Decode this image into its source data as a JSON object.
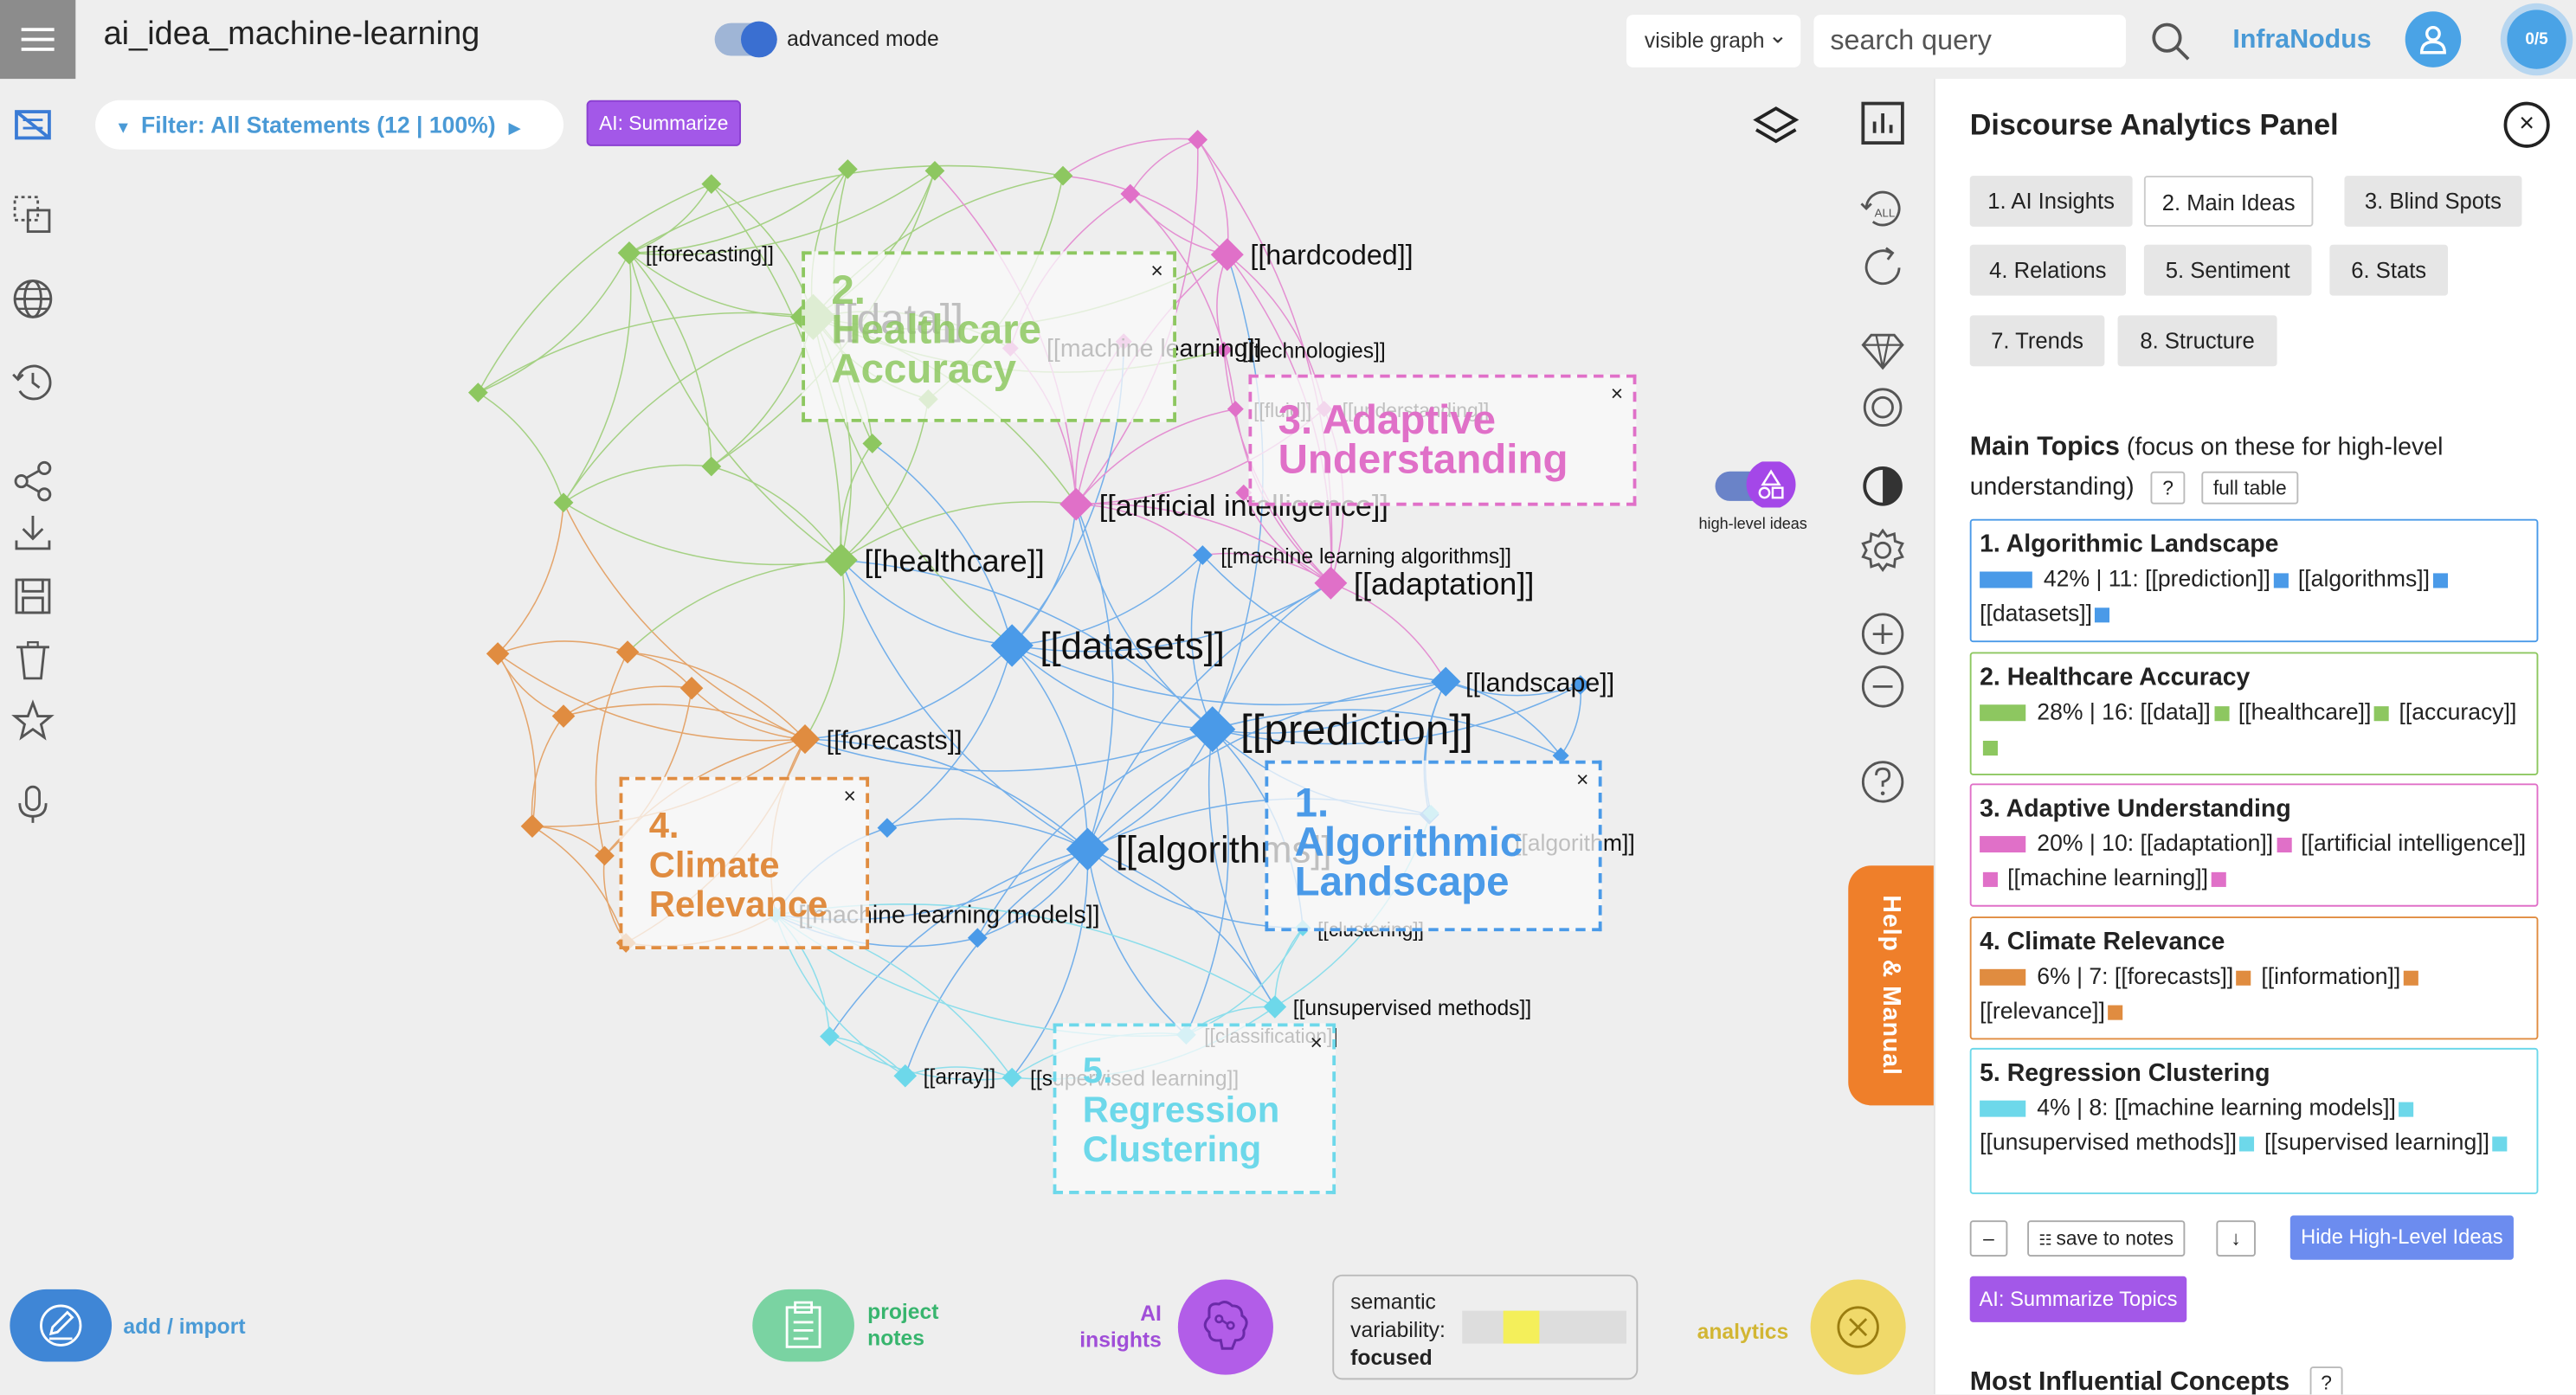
{
  "header": {
    "title": "ai_idea_machine-learning",
    "advanced_mode_label": "advanced mode",
    "graph_select": "visible graph",
    "search_placeholder": "search query",
    "brand": "InfraNodus",
    "counter": "0/5"
  },
  "toolbar": {
    "filter_label": "Filter: All Statements (12 | 100%)",
    "ai_summarize": "AI: Summarize"
  },
  "graph": {
    "topics": [
      {
        "num": "1.",
        "line1": "Algorithmic",
        "line2": "Landscape",
        "color": "#4a9ae8"
      },
      {
        "num": "2.",
        "line1": "Healthcare",
        "line2": "Accuracy",
        "color": "#8dc760"
      },
      {
        "num": "3.",
        "line1": "Adaptive",
        "line2": "Understanding",
        "color": "#e070c8"
      },
      {
        "num": "4.",
        "line1": "Climate",
        "line2": "Relevance",
        "color": "#e08c40"
      },
      {
        "num": "5.",
        "line1": "Regression",
        "line2": "Clustering",
        "color": "#6dd8ea"
      }
    ],
    "close_mark": "×",
    "node_labels": {
      "forecasting": "[[forecasting]]",
      "data": "[[data]]",
      "machine_learning": "[[machine learning]]",
      "technologies": "[[technologies]]",
      "hardcoded": "[[hardcoded]]",
      "fluid": "[[fluid]]",
      "understanding": "[[understanding]]",
      "artificial_intelligence": "[[artificial intelligence]]",
      "healthcare": "[[healthcare]]",
      "ml_algorithms": "[[machine learning algorithms]]",
      "adaptation": "[[adaptation]]",
      "datasets": "[[datasets]]",
      "landscape": "[[landscape]]",
      "prediction": "[[prediction]]",
      "forecasts": "[[forecasts]]",
      "algorithms": "[[algorithms]]",
      "algorithm": "[[algorithm]]",
      "ml_models": "[[machine learning models]]",
      "clustering": "[[clustering]]",
      "unsupervised": "[[unsupervised methods]]",
      "classification": "[[classification]]",
      "array": "[[array]]",
      "supervised": "[[supervised learning]]"
    },
    "high_level_ideas_label": "high-level ideas"
  },
  "help_label": "Help & Manual",
  "panel": {
    "title": "Discourse Analytics Panel",
    "tabs": [
      "1. AI Insights",
      "2. Main Ideas",
      "3. Blind Spots",
      "4. Relations",
      "5. Sentiment",
      "6. Stats",
      "7. Trends",
      "8. Structure"
    ],
    "main_topics_title": "Main Topics",
    "main_topics_note": "(focus on these for high-level understanding)",
    "question_mark": "?",
    "full_table": "full table",
    "topics": [
      {
        "title": "1. Algorithmic Landscape",
        "pct": 42,
        "stat": "42% | 11:",
        "terms": [
          "[[prediction]]",
          "[[algorithms]]",
          "[[datasets]]"
        ],
        "color": "#4a9ae8"
      },
      {
        "title": "2. Healthcare Accuracy",
        "pct": 28,
        "stat": "28% | 16:",
        "terms": [
          "[[data]]",
          "[[healthcare]]",
          "[[accuracy]]"
        ],
        "color": "#8dc760"
      },
      {
        "title": "3. Adaptive Understanding",
        "pct": 20,
        "stat": "20% | 10:",
        "terms": [
          "[[adaptation]]",
          "[[artificial intelligence]]",
          "[[machine learning]]"
        ],
        "color": "#e070c8"
      },
      {
        "title": "4. Climate Relevance",
        "pct": 6,
        "stat": "6% | 7:",
        "terms": [
          "[[forecasts]]",
          "[[information]]",
          "[[relevance]]"
        ],
        "color": "#e08c40"
      },
      {
        "title": "5. Regression Clustering",
        "pct": 4,
        "stat": "4% | 8:",
        "terms": [
          "[[machine learning models]]",
          "[[unsupervised methods]]",
          "[[supervised learning]]"
        ],
        "color": "#6dd8ea"
      }
    ],
    "minus": "–",
    "save_to_notes": "save to notes",
    "down_arrow": "↓",
    "hide_high_level": "Hide High-Level Ideas",
    "summarize_topics": "AI: Summarize Topics",
    "most_influential": "Most Influential Concepts"
  },
  "bottom": {
    "add_import": "add / import",
    "project_notes_1": "project",
    "project_notes_2": "notes",
    "ai_insights_1": "AI",
    "ai_insights_2": "insights",
    "semantic_1": "semantic",
    "semantic_2": "variability:",
    "semantic_value": "focused",
    "analytics": "analytics"
  }
}
